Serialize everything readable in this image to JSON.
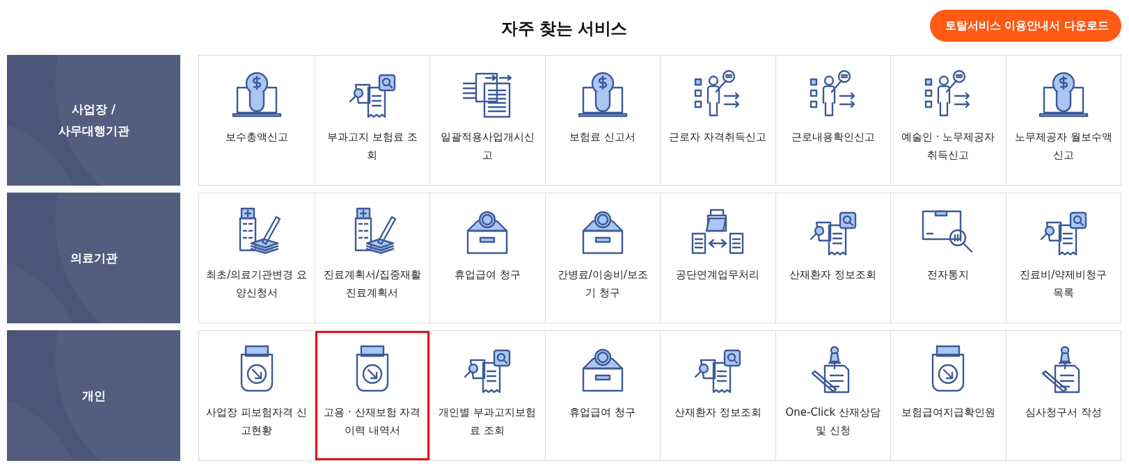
{
  "title": "자주 찾는 서비스",
  "download_button": "토탈서비스 이용안내서 다운로드",
  "groups": [
    {
      "label": "사업장 / 사무대행기관",
      "services": [
        {
          "kind": "bulb",
          "label": "보수총액신고",
          "highlighted": false
        },
        {
          "kind": "docsearch",
          "label": "부과고지 보험료 조회",
          "highlighted": false
        },
        {
          "kind": "transfer",
          "label": "일괄적용사업개시신고",
          "highlighted": false
        },
        {
          "kind": "bulb",
          "label": "보험료 신고서",
          "highlighted": false
        },
        {
          "kind": "presenter",
          "label": "근로자 자격취득신고",
          "highlighted": false
        },
        {
          "kind": "presenter",
          "label": "근로내용확인신고",
          "highlighted": false
        },
        {
          "kind": "presenter",
          "label": "예술인 · 노무제공자 취득신고",
          "highlighted": false
        },
        {
          "kind": "bulb",
          "label": "노무제공자 월보수액 신고",
          "highlighted": false
        }
      ]
    },
    {
      "label": "의료기관",
      "services": [
        {
          "kind": "hospital",
          "label": "최초/의료기관변경 요양신청서",
          "highlighted": false
        },
        {
          "kind": "hospital",
          "label": "진료계획서/집중재활진료계획서",
          "highlighted": false
        },
        {
          "kind": "coinbox",
          "label": "휴업급여 청구",
          "highlighted": false
        },
        {
          "kind": "coinbox",
          "label": "간병료/이송비/보조기 청구",
          "highlighted": false
        },
        {
          "kind": "folder",
          "label": "공단연계업무처리",
          "highlighted": false
        },
        {
          "kind": "docsearch",
          "label": "산재환자 정보조회",
          "highlighted": false
        },
        {
          "kind": "package",
          "label": "전자통지",
          "highlighted": false
        },
        {
          "kind": "docsearch",
          "label": "진료비/약제비청구 목록",
          "highlighted": false
        }
      ]
    },
    {
      "label": "개인",
      "services": [
        {
          "kind": "tray",
          "label": "사업장 피보험자격 신고현황",
          "highlighted": false
        },
        {
          "kind": "tray",
          "label": "고용 · 산재보험 자격 이력 내역서",
          "highlighted": true
        },
        {
          "kind": "docsearch",
          "label": "개인별 부과고지보험료 조회",
          "highlighted": false
        },
        {
          "kind": "coinbox",
          "label": "휴업급여 청구",
          "highlighted": false
        },
        {
          "kind": "docsearch",
          "label": "산재환자 정보조회",
          "highlighted": false
        },
        {
          "kind": "pin",
          "label": "One-Click 산재상담 및 신청",
          "highlighted": false
        },
        {
          "kind": "tray",
          "label": "보험급여지급확인원",
          "highlighted": false
        },
        {
          "kind": "pin",
          "label": "심사청구서 작성",
          "highlighted": false
        }
      ]
    }
  ]
}
